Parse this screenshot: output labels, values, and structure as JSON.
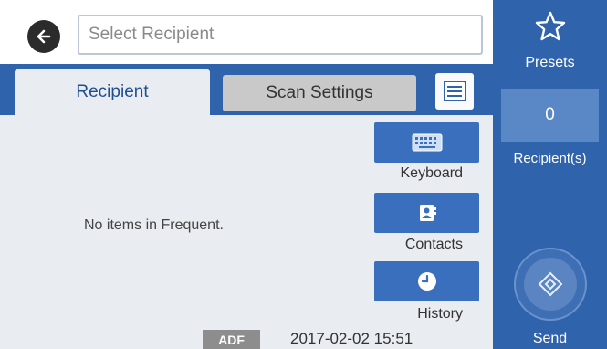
{
  "header": {
    "search_placeholder": "Select Recipient"
  },
  "tabs": {
    "recipient_label": "Recipient",
    "scan_settings_label": "Scan Settings"
  },
  "content": {
    "empty_message": "No items in Frequent."
  },
  "tools": {
    "keyboard_label": "Keyboard",
    "contacts_label": "Contacts",
    "history_label": "History"
  },
  "status": {
    "source_badge": "ADF",
    "datetime": "2017-02-02 15:51"
  },
  "right_panel": {
    "presets_label": "Presets",
    "recipient_count": "0",
    "recipient_count_label": "Recipient(s)",
    "send_label": "Send"
  },
  "icons": {
    "back": "back-arrow-icon",
    "menu": "menu-list-icon",
    "keyboard": "keyboard-icon",
    "contacts": "contacts-book-icon",
    "history": "clock-icon",
    "presets": "star-icon",
    "send": "send-diamond-icon"
  },
  "colors": {
    "accent": "#2f64ad",
    "tool_button": "#3a6fbe",
    "content_bg": "#e9ecf1",
    "badge": "#8d8d8d"
  }
}
